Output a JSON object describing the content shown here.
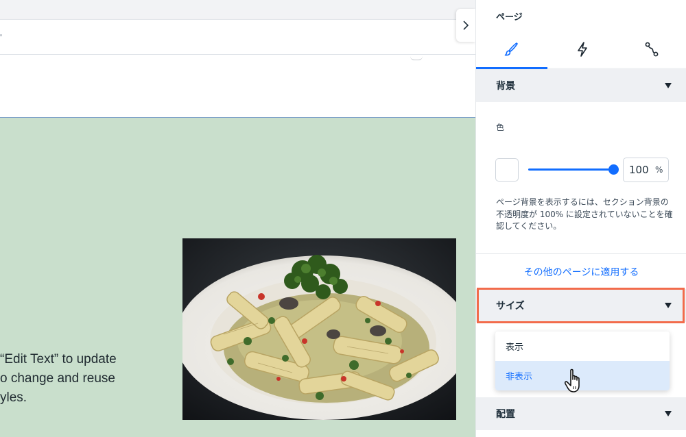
{
  "canvas": {
    "section_text_lines": [
      "“Edit Text” to update",
      "o change and reuse",
      "yles."
    ]
  },
  "panel": {
    "title": "ページ",
    "tabs": [
      {
        "name": "design",
        "icon": "brush-icon",
        "active": true
      },
      {
        "name": "interactions",
        "icon": "lightning-icon",
        "active": false
      },
      {
        "name": "connections",
        "icon": "connect-icon",
        "active": false
      }
    ],
    "background_section": {
      "label": "背景",
      "color_label": "色",
      "swatch_color": "#ffffff",
      "opacity_value": "100",
      "opacity_unit": "%",
      "note": "ページ背景を表示するには、セクション背景の不透明度が 100% に設定されていないことを確認してください。"
    },
    "apply_link": "その他のページに適用する",
    "size_section": {
      "label": "サイズ",
      "options": [
        {
          "label": "表示",
          "hovered": false
        },
        {
          "label": "非表示",
          "hovered": true
        }
      ]
    },
    "align_section": {
      "label": "配置"
    }
  },
  "colors": {
    "accent": "#116dff",
    "highlight": "#f26b4b",
    "section_bg": "#c9dfcc"
  }
}
